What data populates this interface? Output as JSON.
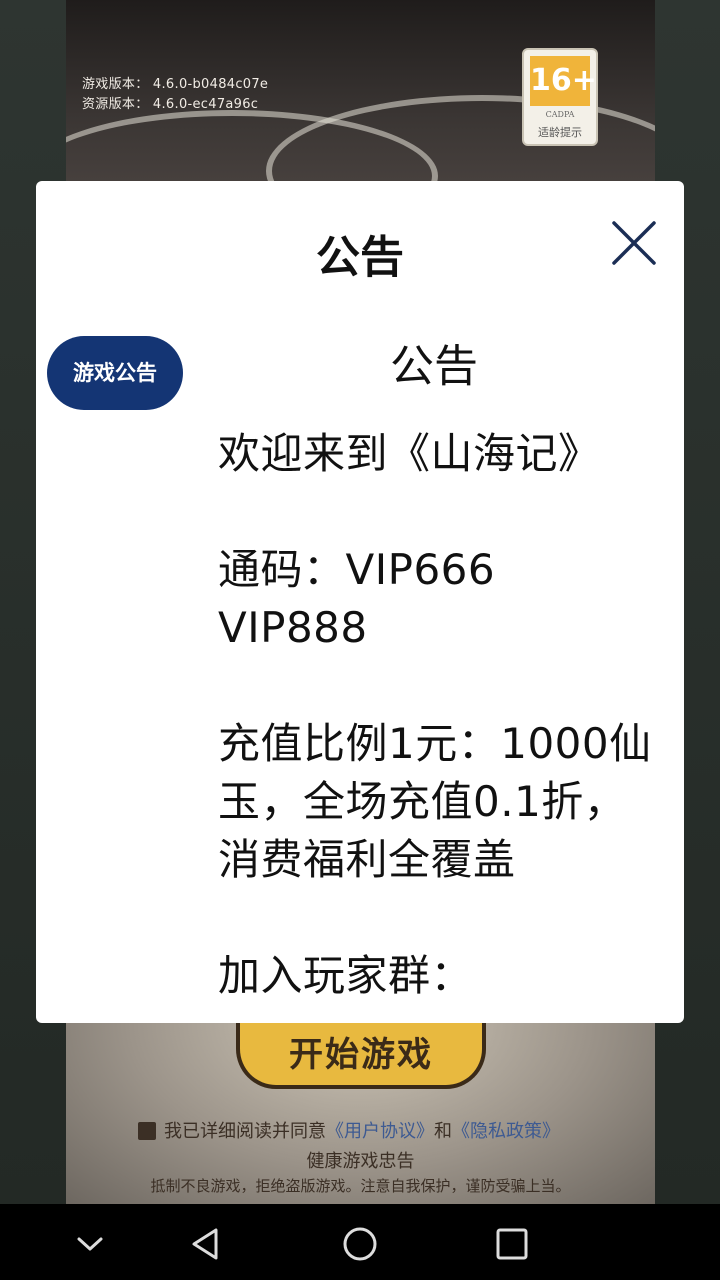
{
  "background": {
    "version_lines": [
      "游戏版本： 4.6.0-b0484c07e",
      "资源版本： 4.6.0-ec47a96c"
    ],
    "age_rating": {
      "label": "16+",
      "org": "CADPA",
      "tip": "适龄提示"
    },
    "start_button": "开始游戏",
    "agreement": {
      "prefix": "我已详细阅读并同意",
      "user_agreement": "《用户协议》",
      "and": "和",
      "privacy_policy": "《隐私政策》"
    },
    "health_title": "健康游戏忠告",
    "health_line": "抵制不良游戏，拒绝盗版游戏。注意自我保护，谨防受骗上当。"
  },
  "dialog": {
    "title": "公告",
    "tab": "游戏公告",
    "content_title": "公告",
    "paragraphs": [
      "欢迎来到《山海记》",
      "通码：VIP666 VIP888",
      "充值比例1元：1000仙玉，全场充值0.1折，消费福利全覆盖",
      "加入玩家群："
    ]
  },
  "colors": {
    "tab_bg": "#143574",
    "dialog_bg": "#ffffff",
    "start_button": "#e8b93f"
  },
  "navbar": {
    "icons": [
      "chevron-down-icon",
      "back-triangle-icon",
      "home-circle-icon",
      "recents-square-icon"
    ]
  }
}
